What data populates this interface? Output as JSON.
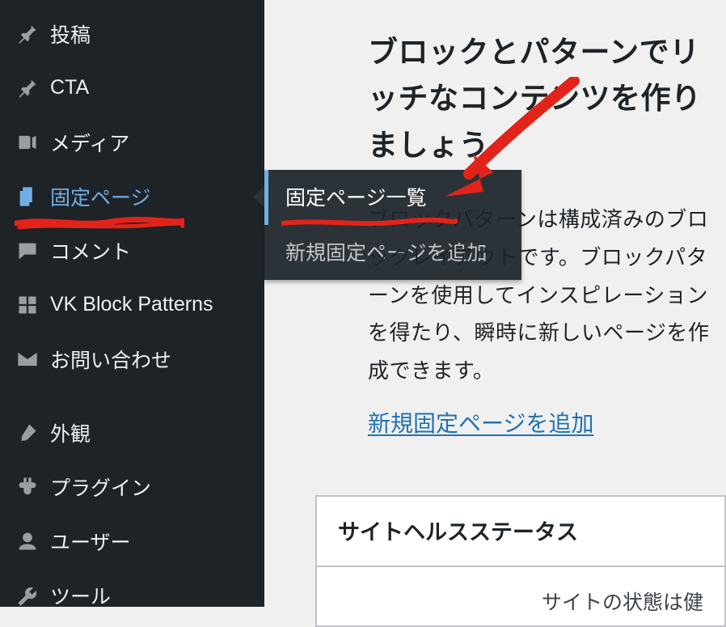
{
  "sidebar": {
    "items": [
      {
        "icon": "pin",
        "label": "投稿"
      },
      {
        "icon": "pin",
        "label": "CTA"
      },
      {
        "icon": "media",
        "label": "メディア"
      },
      {
        "icon": "page",
        "label": "固定ページ",
        "current": true
      },
      {
        "icon": "comment",
        "label": "コメント"
      },
      {
        "icon": "grid",
        "label": "VK Block Patterns"
      },
      {
        "icon": "mail",
        "label": "お問い合わせ"
      },
      {
        "icon": "brush",
        "label": "外観"
      },
      {
        "icon": "plugin",
        "label": "プラグイン"
      },
      {
        "icon": "user",
        "label": "ユーザー"
      },
      {
        "icon": "wrench",
        "label": "ツール"
      }
    ]
  },
  "flyout": {
    "items": [
      {
        "label": "固定ページ一覧",
        "current": true
      },
      {
        "label": "新規固定ページを追加"
      }
    ]
  },
  "panel": {
    "heading": "ブロックとパターンでリッチなコンテンツを作りましょう",
    "body": "ブロックパターンは構成済みのブロックレイアウトです。ブロックパターンを使用してインスピレーションを得たり、瞬時に新しいページを作成できます。",
    "link": "新規固定ページを追加"
  },
  "site_health": {
    "title": "サイトヘルスステータス",
    "body": "サイトの状態は健"
  }
}
